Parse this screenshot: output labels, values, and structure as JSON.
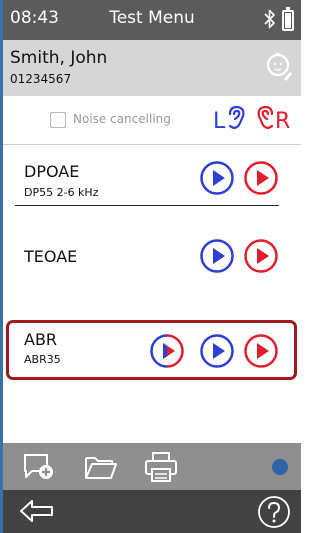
{
  "status_bar": {
    "time": "08:43",
    "title": "Test Menu"
  },
  "patient": {
    "name": "Smith, John",
    "id": "01234567"
  },
  "options": {
    "noise_cancelling_label": "Noise cancelling",
    "noise_cancelling_checked": false,
    "left_ear_label": "L",
    "right_ear_label": "R"
  },
  "tests": [
    {
      "name": "DPOAE",
      "subtitle": "DP55 2-6 kHz",
      "selected": false
    },
    {
      "name": "TEOAE",
      "subtitle": "",
      "selected": false
    },
    {
      "name": "ABR",
      "subtitle": "ABR35",
      "selected": true
    }
  ],
  "colors": {
    "status_bar": "#5b5b5b",
    "patient_bar": "#d6d6d6",
    "left_ear": "#2d3fd4",
    "right_ear": "#e01e2c",
    "selected_border": "#9c1b1e",
    "toolbar": "#8f8f8f",
    "nav_bar": "#424242",
    "status_dot": "#2e63a7"
  },
  "icons": {
    "bluetooth": "bluetooth-icon",
    "battery": "battery-icon",
    "patient": "baby-patient-icon",
    "add_comment": "add-comment-icon",
    "folder": "folder-icon",
    "print": "printer-icon",
    "back": "back-arrow-icon",
    "help": "help-icon"
  }
}
